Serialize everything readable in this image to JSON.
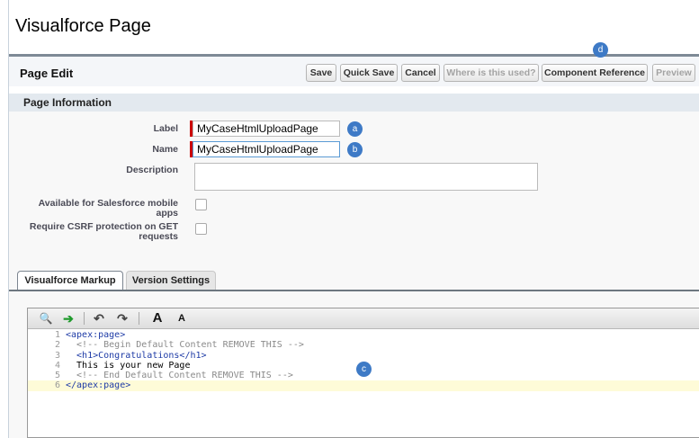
{
  "page": {
    "title": "Visualforce Page"
  },
  "edit_bar": {
    "title": "Page Edit",
    "buttons": {
      "save": "Save",
      "quick_save": "Quick Save",
      "cancel": "Cancel",
      "where_used": "Where is this used?",
      "component_reference": "Component Reference",
      "preview": "Preview"
    }
  },
  "section": {
    "title": "Page Information"
  },
  "form": {
    "label": {
      "label": "Label",
      "value": "MyCaseHtmlUploadPage"
    },
    "name": {
      "label": "Name",
      "value": "MyCaseHtmlUploadPage"
    },
    "description": {
      "label": "Description",
      "value": ""
    },
    "mobile": {
      "label_line1": "Available for Salesforce mobile",
      "label_line2": "apps",
      "checked": false
    },
    "csrf": {
      "label_line1": "Require CSRF protection on GET",
      "label_line2": "requests",
      "checked": false
    }
  },
  "tabs": [
    {
      "label": "Visualforce Markup",
      "active": true
    },
    {
      "label": "Version Settings",
      "active": false
    }
  ],
  "toolbar": {
    "search": "🔍",
    "goto": "➔",
    "undo": "↶",
    "redo": "↷",
    "font_larger": "A",
    "font_smaller": "A"
  },
  "code": {
    "lines": [
      {
        "num": "1",
        "text": "<apex:page>",
        "kind": "tag"
      },
      {
        "num": "2",
        "text": "  <!-- Begin Default Content REMOVE THIS -->",
        "kind": "cmt"
      },
      {
        "num": "3",
        "text": "  <h1>Congratulations</h1>",
        "kind": "mixed"
      },
      {
        "num": "4",
        "text": "  This is your new Page",
        "kind": "txt"
      },
      {
        "num": "5",
        "text": "  <!-- End Default Content REMOVE THIS -->",
        "kind": "cmt"
      },
      {
        "num": "6",
        "text": "</apex:page>",
        "kind": "tag"
      }
    ]
  },
  "callouts": {
    "a": "a",
    "b": "b",
    "c": "c",
    "d": "d"
  }
}
